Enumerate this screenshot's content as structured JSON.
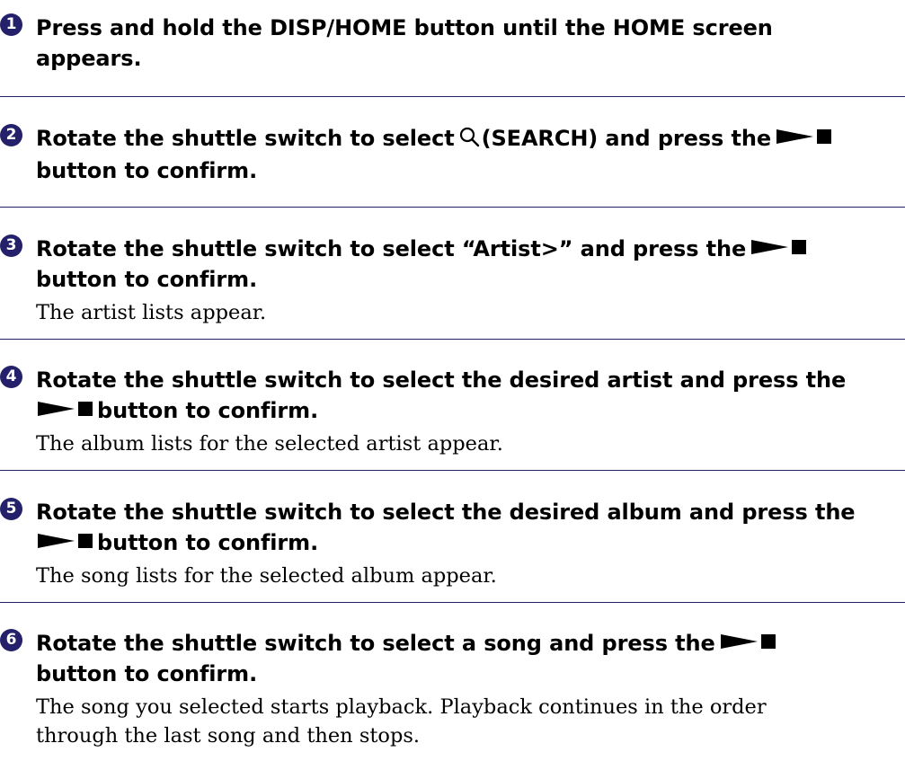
{
  "steps": [
    {
      "number": "1",
      "line1": "Press and hold the DISP/HOME button until the HOME screen",
      "line2": "appears."
    },
    {
      "number": "2",
      "line1_before": "Rotate the shuttle switch to select",
      "line1_after": "(SEARCH) and press the",
      "line2": "button to confirm."
    },
    {
      "number": "3",
      "line1_before": "Rotate the shuttle switch to select “Artist>” and press the",
      "line2": "button to confirm.",
      "description": "The artist lists appear."
    },
    {
      "number": "4",
      "line1": "Rotate the shuttle switch to select the desired artist and press the",
      "line2_after": "button to confirm.",
      "description": "The album lists for the selected artist appear."
    },
    {
      "number": "5",
      "line1": "Rotate the shuttle switch to select the desired album and press the",
      "line2_after": "button to confirm.",
      "description": "The song lists for the selected album appear."
    },
    {
      "number": "6",
      "line1_before": "Rotate the shuttle switch to select a song and press the",
      "line2": "button to confirm.",
      "description_line1": "The song you selected starts playback. Playback continues in the order",
      "description_line2": "through the last song and then stops."
    }
  ],
  "icons": {
    "search": "search-icon",
    "play_stop": "play-stop-icon"
  },
  "colors": {
    "step_badge": "#24206a",
    "divider": "#24206a",
    "text": "#000000"
  }
}
